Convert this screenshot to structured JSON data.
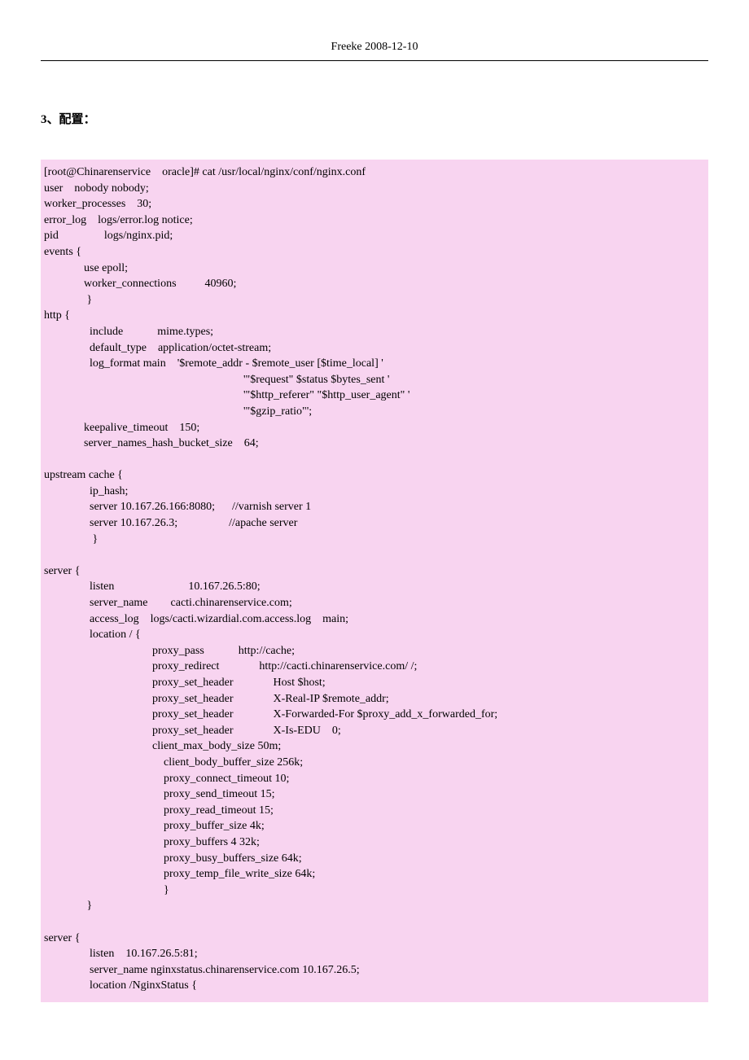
{
  "header": {
    "text": "Freeke 2008-12-10"
  },
  "section": {
    "title": "3、配置："
  },
  "config": {
    "code": "[root@Chinarenservice    oracle]# cat /usr/local/nginx/conf/nginx.conf\nuser    nobody nobody;\nworker_processes    30;\nerror_log    logs/error.log notice;\npid                logs/nginx.pid;\nevents {\n              use epoll;\n              worker_connections          40960;\n               }\nhttp {\n                include            mime.types;\n                default_type    application/octet-stream;\n                log_format main    '$remote_addr - $remote_user [$time_local] '\n                                                                      '\"$request\" $status $bytes_sent '\n                                                                      '\"$http_referer\" \"$http_user_agent\" '\n                                                                      '\"$gzip_ratio\"';\n              keepalive_timeout    150;\n              server_names_hash_bucket_size    64;\n\nupstream cache {\n                ip_hash;\n                server 10.167.26.166:8080;      //varnish server 1\n                server 10.167.26.3;                  //apache server\n                 }\n\nserver {\n                listen                          10.167.26.5:80;\n                server_name        cacti.chinarenservice.com;\n                access_log    logs/cacti.wizardial.com.access.log    main;\n                location / {\n                                      proxy_pass            http://cache;\n                                      proxy_redirect              http://cacti.chinarenservice.com/ /;\n                                      proxy_set_header              Host $host;\n                                      proxy_set_header              X-Real-IP $remote_addr;\n                                      proxy_set_header              X-Forwarded-For $proxy_add_x_forwarded_for;\n                                      proxy_set_header              X-Is-EDU    0;\n                                      client_max_body_size 50m;\n                                          client_body_buffer_size 256k;\n                                          proxy_connect_timeout 10;\n                                          proxy_send_timeout 15;\n                                          proxy_read_timeout 15;\n                                          proxy_buffer_size 4k;\n                                          proxy_buffers 4 32k;\n                                          proxy_busy_buffers_size 64k;\n                                          proxy_temp_file_write_size 64k;\n                                          }\n               }\n\nserver {\n                listen    10.167.26.5:81;\n                server_name nginxstatus.chinarenservice.com 10.167.26.5;\n                location /NginxStatus {"
  }
}
